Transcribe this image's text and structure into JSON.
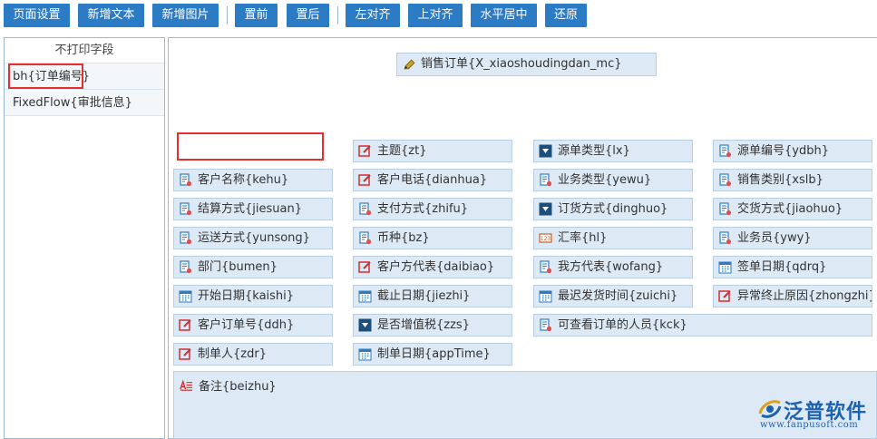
{
  "toolbar": {
    "buttons": [
      "页面设置",
      "新增文本",
      "新增图片",
      "置前",
      "置后",
      "左对齐",
      "上对齐",
      "水平居中",
      "还原"
    ]
  },
  "left_panel": {
    "title": "不打印字段",
    "items": [
      "bh{订单编号}",
      "FixedFlow{审批信息}"
    ]
  },
  "canvas": {
    "title_field": "销售订单{X_xiaoshoudingdan_mc}",
    "fields": [
      {
        "label": "主题{zt}",
        "icon": "edit-icon"
      },
      {
        "label": "源单类型{lx}",
        "icon": "dropdown-icon"
      },
      {
        "label": "源单编号{ydbh}",
        "icon": "doc-icon"
      },
      {
        "label": "客户名称{kehu}",
        "icon": "doc-icon"
      },
      {
        "label": "客户电话{dianhua}",
        "icon": "edit-icon"
      },
      {
        "label": "业务类型{yewu}",
        "icon": "doc-icon"
      },
      {
        "label": "销售类别{xslb}",
        "icon": "doc-icon"
      },
      {
        "label": "结算方式{jiesuan}",
        "icon": "doc-icon"
      },
      {
        "label": "支付方式{zhifu}",
        "icon": "doc-icon"
      },
      {
        "label": "订货方式{dinghuo}",
        "icon": "dropdown-icon"
      },
      {
        "label": "交货方式{jiaohuo}",
        "icon": "doc-icon"
      },
      {
        "label": "运送方式{yunsong}",
        "icon": "doc-icon"
      },
      {
        "label": "币种{bz}",
        "icon": "doc-icon"
      },
      {
        "label": "汇率{hl}",
        "icon": "number-icon"
      },
      {
        "label": "业务员{ywy}",
        "icon": "doc-icon"
      },
      {
        "label": "部门{bumen}",
        "icon": "doc-icon"
      },
      {
        "label": "客户方代表{daibiao}",
        "icon": "edit-icon"
      },
      {
        "label": "我方代表{wofang}",
        "icon": "doc-icon"
      },
      {
        "label": "签单日期{qdrq}",
        "icon": "calendar-icon"
      },
      {
        "label": "开始日期{kaishi}",
        "icon": "calendar-icon"
      },
      {
        "label": "截止日期{jiezhi}",
        "icon": "calendar-icon"
      },
      {
        "label": "最迟发货时间{zuichi}",
        "icon": "calendar-icon"
      },
      {
        "label": "异常终止原因{zhongzhi}",
        "icon": "edit-icon"
      },
      {
        "label": "客户订单号{ddh}",
        "icon": "edit-icon"
      },
      {
        "label": "是否增值税{zzs}",
        "icon": "dropdown-icon"
      },
      {
        "label": "可查看订单的人员{kck}",
        "icon": "doc-icon"
      },
      {
        "label": "制单人{zdr}",
        "icon": "edit-icon"
      },
      {
        "label": "制单日期{appTime}",
        "icon": "calendar-icon"
      }
    ],
    "note_field": "备注{beizhu}"
  },
  "logo": {
    "name": "泛普软件",
    "url": "www.fanpusoft.com"
  },
  "colors": {
    "toolbar_button": "#2b7cc4",
    "field_bg": "#dde9f4",
    "highlight_red": "#e03030",
    "brand_blue": "#1d62b0"
  }
}
